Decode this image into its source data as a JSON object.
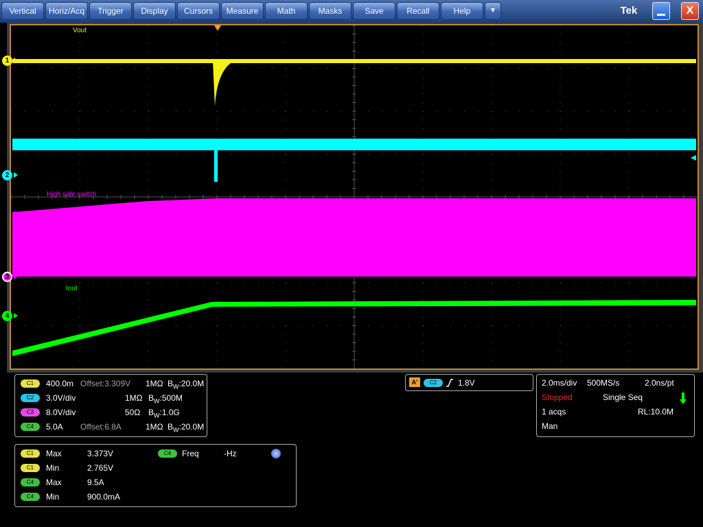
{
  "menu": {
    "vertical": "Vertical",
    "horiz_acq": "Horiz/Acq",
    "trigger": "Trigger",
    "display": "Display",
    "cursors": "Cursors",
    "measure": "Measure",
    "math": "Math",
    "masks": "Masks",
    "save": "Save",
    "recall": "Recall",
    "help": "Help",
    "dropdown": "▼"
  },
  "window": {
    "logo": "Tek",
    "close": "X"
  },
  "colors": {
    "ch1": "#f5f018",
    "ch2": "#00ffff",
    "ch3": "#ff00ff",
    "ch4": "#00ff00",
    "graticule_frame": "#c08a35",
    "menubar": "#2c56a2"
  },
  "traces": {
    "ch1_label": "Vout",
    "ch3_label": "High side switch",
    "ch4_label": "Iout"
  },
  "markers": {
    "ch1": "1",
    "ch2": "2",
    "ch3": "3",
    "ch4": "4"
  },
  "channels": [
    {
      "badge": "C1",
      "scale": "400.0m",
      "offset": "Offset:3.309V",
      "imp": "1MΩ",
      "bw": "B",
      "bw_sub": "W",
      "bw_val": ":20.0M"
    },
    {
      "badge": "C2",
      "scale": "3.0V/div",
      "offset": "",
      "imp": "1MΩ",
      "bw": "B",
      "bw_sub": "W",
      "bw_val": ":500M"
    },
    {
      "badge": "C3",
      "scale": "8.0V/div",
      "offset": "",
      "imp": "50Ω",
      "bw": "B",
      "bw_sub": "W",
      "bw_val": ":1.0G"
    },
    {
      "badge": "C4",
      "scale": "5.0A",
      "offset": "Offset:6.8A",
      "imp": "1MΩ",
      "bw": "B",
      "bw_sub": "W",
      "bw_val": ":20.0M"
    }
  ],
  "trigger": {
    "mode": "A'",
    "source": "C2",
    "level": "1.8V"
  },
  "acquisition": {
    "timebase": "2.0ms/div",
    "sample_rate": "500MS/s",
    "resolution": "2.0ns/pt",
    "status": "Stopped",
    "mode": "Single Seq",
    "acqs": "1 acqs",
    "record_length": "RL:10.0M",
    "trigger_mode": "Man"
  },
  "measurements": [
    {
      "badge": "C1",
      "name": "Max",
      "value": "3.373V"
    },
    {
      "badge": "C1",
      "name": "Min",
      "value": "2.765V"
    },
    {
      "badge": "C4",
      "name": "Max",
      "value": "9.5A"
    },
    {
      "badge": "C4",
      "name": "Min",
      "value": "900.0mA"
    }
  ],
  "freq_meas": {
    "badge": "C4",
    "name": "Freq",
    "value": "-Hz"
  }
}
